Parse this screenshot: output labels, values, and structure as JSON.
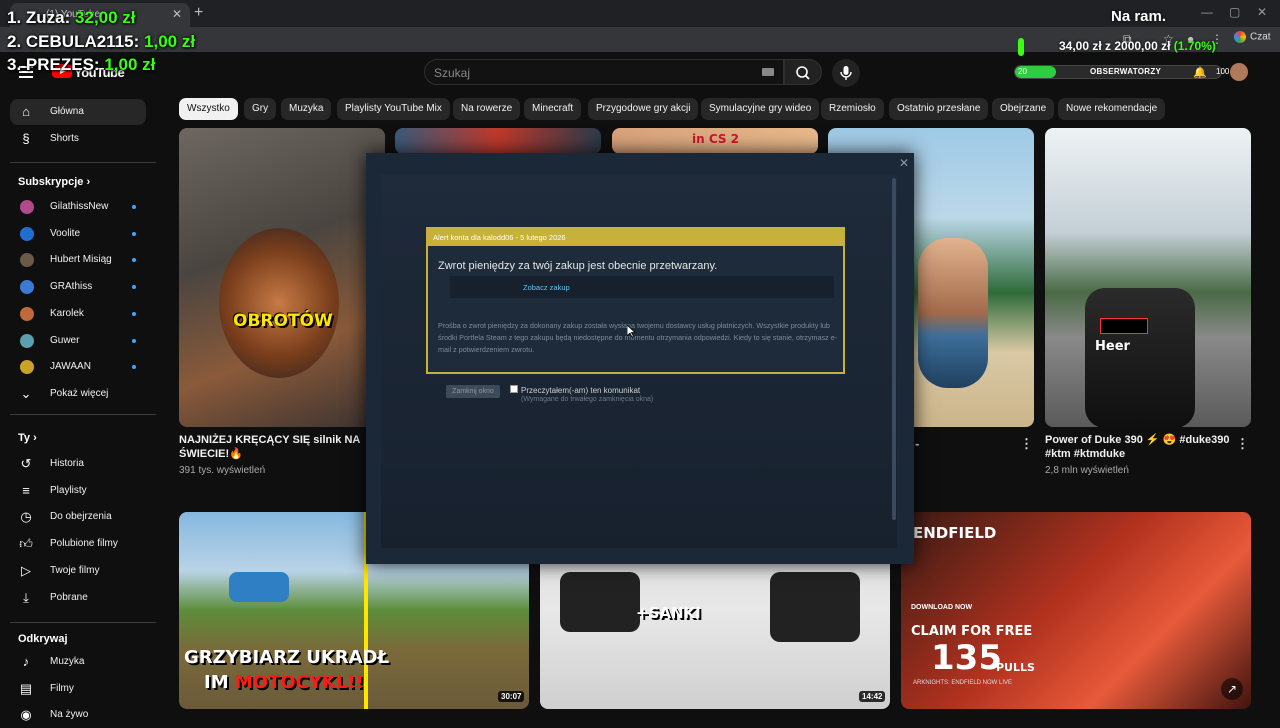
{
  "browser": {
    "tab_title": "(1) YouTube",
    "chat_label": "Czat"
  },
  "overlay": {
    "donors": [
      {
        "rank_name": "1. Zuza:",
        "amount": "32,00 zł"
      },
      {
        "rank_name": "2. CEBULA2115:",
        "amount": "1,00 zł"
      },
      {
        "rank_name": "3. PREZES:",
        "amount": "1,00 zł"
      }
    ],
    "title": "Na ram.",
    "goal": {
      "current_target": "34,00 zł z 2000,00 zł",
      "percent": "(1.70%)",
      "fraction": 0.017
    },
    "xp": {
      "left": "20",
      "label": "OBSERWATORZY",
      "right": "100",
      "fraction": 0.2
    }
  },
  "youtube": {
    "logo_text": "YouTube",
    "search_placeholder": "Szukaj",
    "sidebar": {
      "main": [
        {
          "label": "Główna",
          "icon": "home-icon",
          "active": true
        },
        {
          "label": "Shorts",
          "icon": "shorts-icon"
        }
      ],
      "subs_header": "Subskrypcje",
      "subs": [
        {
          "label": "GilathissNew",
          "color": "#b04a8a"
        },
        {
          "label": "Voolite",
          "color": "#1f6fd1"
        },
        {
          "label": "Hubert Misiąg",
          "color": "#6b5a4a"
        },
        {
          "label": "GRAthiss",
          "color": "#3a7bd5"
        },
        {
          "label": "Karolek",
          "color": "#c06a3a"
        },
        {
          "label": "Guwer",
          "color": "#5aa0b0"
        },
        {
          "label": "JAWAAN",
          "color": "#c9a227"
        }
      ],
      "show_more": "Pokaż więcej",
      "you_header": "Ty",
      "you": [
        {
          "label": "Historia",
          "icon": "history-icon"
        },
        {
          "label": "Playlisty",
          "icon": "playlist-icon"
        },
        {
          "label": "Do obejrzenia",
          "icon": "clock-icon"
        },
        {
          "label": "Polubione filmy",
          "icon": "thumb-up-icon"
        },
        {
          "label": "Twoje filmy",
          "icon": "video-icon"
        },
        {
          "label": "Pobrane",
          "icon": "download-icon"
        }
      ],
      "explore_header": "Odkrywaj",
      "explore": [
        {
          "label": "Muzyka",
          "icon": "music-icon"
        },
        {
          "label": "Filmy",
          "icon": "film-icon"
        },
        {
          "label": "Na żywo",
          "icon": "live-icon"
        }
      ]
    },
    "chips": [
      "Wszystko",
      "Gry",
      "Muzyka",
      "Playlisty YouTube Mix",
      "Na rowerze",
      "Minecraft",
      "Przygodowe gry akcji",
      "Symulacyjne gry wideo",
      "Rzemiosło",
      "Ostatnio przesłane",
      "Obejrzane",
      "Nowe rekomendacje"
    ],
    "videos": [
      {
        "title": "NAJNIŻEJ KRĘCĄCY SIĘ silnik NA ŚWIECIE!🔥",
        "meta": "391 tys. wyświetleń",
        "overlay": "OBROTÓW"
      },
      {
        "title": "Power of Duke 390 ⚡ 😍 #duke390 #ktm #ktmduke",
        "meta": "2,8 mln wyświetleń",
        "overlay": "Heer"
      },
      {
        "overlay_line1": "GRZYBIARZ UKRADŁ",
        "overlay_line2a": "IM ",
        "overlay_line2b": "MOTOCYKL!!",
        "duration": "30:07"
      },
      {
        "overlay": "+SANKI",
        "duration": "14:42"
      },
      {
        "overlay_top": "ENDFIELD",
        "badge": "DOWNLOAD NOW",
        "claim": "CLAIM FOR FREE",
        "big_number": "135",
        "pulls": "PULLS",
        "footer": "ARKNIGHTS: ENDFIELD NOW LIVE"
      },
      {
        "overlay": "in CS 2"
      }
    ]
  },
  "steam_dialog": {
    "header": "Alert konta dla kalodd06 - 5 lutego 2026",
    "message": "Zwrot pieniędzy za twój zakup jest obecnie przetwarzany.",
    "link": "Zobacz zakup",
    "body": "Prośba o zwrot pieniędzy za dokonany zakup została wysłana twojemu dostawcy usług płatniczych. Wszystkie produkty lub środki Portfela Steam z tego zakupu będą niedostępne do momentu otrzymania odpowiedzi. Kiedy to się stanie, otrzymasz e-mail z potwierdzeniem zwrotu.",
    "close_button": "Zamknij okno",
    "checkbox_label": "Przeczytałem(-am) ten komunikat",
    "checkbox_note": "(Wymagane do trwałego zamknięcia okna)",
    "checkbox_checked": false,
    "accent": "#c8b13a"
  }
}
